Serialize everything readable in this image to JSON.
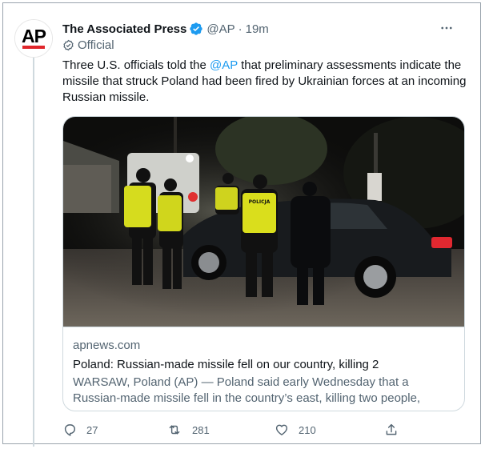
{
  "author": {
    "display_name": "The Associated Press",
    "handle": "@AP",
    "separator": "·",
    "time": "19m",
    "label": "Official",
    "avatar_text": "AP"
  },
  "tweet": {
    "text_before": "Three U.S. officials told the ",
    "mention": "@AP",
    "text_after": " that preliminary assessments indicate the missile that struck Poland had been fired by Ukrainian forces at an incoming Russian missile."
  },
  "card": {
    "image_text": "POLICJA",
    "domain": "apnews.com",
    "title": "Poland: Russian-made missile fell on our country, killing 2",
    "description": "WARSAW, Poland (AP) — Poland said early Wednesday that a Russian-made missile fell in the country’s east, killing two people, though U.S. ..."
  },
  "actions": {
    "replies": "27",
    "retweets": "281",
    "likes": "210"
  },
  "icons": {
    "reply": "reply-icon",
    "retweet": "retweet-icon",
    "like": "heart-icon",
    "share": "share-icon",
    "verified": "verified-badge-icon",
    "official": "official-check-icon",
    "more": "more-options-icon"
  },
  "colors": {
    "accent": "#1d9bf0",
    "secondary_text": "#536471",
    "primary_text": "#0f1419",
    "brand_red": "#e0262b"
  }
}
